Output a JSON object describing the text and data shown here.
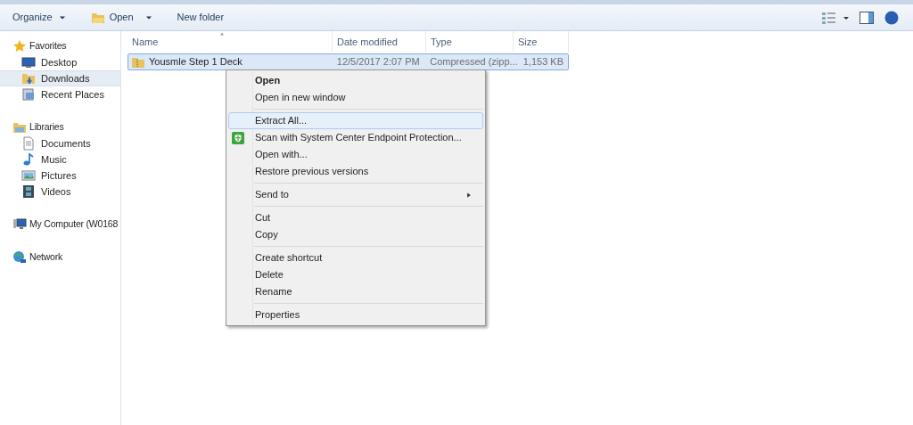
{
  "toolbar": {
    "buttons": [
      {
        "label": "Organize",
        "kind": "dropdown"
      },
      {
        "label": "Open",
        "kind": "open"
      },
      {
        "label": "New folder",
        "kind": "plain"
      }
    ]
  },
  "sidebar": {
    "groups": [
      {
        "label": "Favorites",
        "children": [
          {
            "label": "Desktop",
            "selected": false
          },
          {
            "label": "Downloads",
            "selected": true
          },
          {
            "label": "Recent Places",
            "selected": false
          }
        ]
      },
      {
        "label": "Libraries",
        "children": [
          {
            "label": "Documents",
            "selected": false
          },
          {
            "label": "Music",
            "selected": false
          },
          {
            "label": "Pictures",
            "selected": false
          },
          {
            "label": "Videos",
            "selected": false
          }
        ]
      },
      {
        "label": "My Computer (W0168"
      },
      {
        "label": "Network"
      }
    ]
  },
  "table": {
    "columns": [
      "Name",
      "Date modified",
      "Type",
      "Size"
    ],
    "rows": [
      {
        "name": "Yousmle Step 1 Deck",
        "date": "12/5/2017 2:07 PM",
        "type": "Compressed (zipp...",
        "size": "1,153 KB",
        "selected": true
      }
    ]
  },
  "context_menu": {
    "items": [
      {
        "kind": "item",
        "label": "Open",
        "default": true,
        "selected": false
      },
      {
        "kind": "item",
        "label": "Open in new window",
        "default": false,
        "selected": false
      },
      {
        "kind": "separator"
      },
      {
        "kind": "item",
        "label": "Extract All...",
        "default": false,
        "selected": true
      },
      {
        "kind": "icon_item",
        "label": "Scan with System Center Endpoint Protection...",
        "default": false,
        "selected": false
      },
      {
        "kind": "item",
        "label": "Open with...",
        "default": false,
        "selected": false
      },
      {
        "kind": "item",
        "label": "Restore previous versions",
        "default": false,
        "selected": false
      },
      {
        "kind": "separator"
      },
      {
        "kind": "submenu",
        "label": "Send to",
        "default": false,
        "selected": false
      },
      {
        "kind": "separator"
      },
      {
        "kind": "item",
        "label": "Cut",
        "default": false,
        "selected": false
      },
      {
        "kind": "item",
        "label": "Copy",
        "default": false,
        "selected": false
      },
      {
        "kind": "separator"
      },
      {
        "kind": "item",
        "label": "Create shortcut",
        "default": false,
        "selected": false
      },
      {
        "kind": "item",
        "label": "Delete",
        "default": false,
        "selected": false
      },
      {
        "kind": "item",
        "label": "Rename",
        "default": false,
        "selected": false
      },
      {
        "kind": "separator"
      },
      {
        "kind": "item",
        "label": "Properties",
        "default": false,
        "selected": false
      }
    ]
  }
}
